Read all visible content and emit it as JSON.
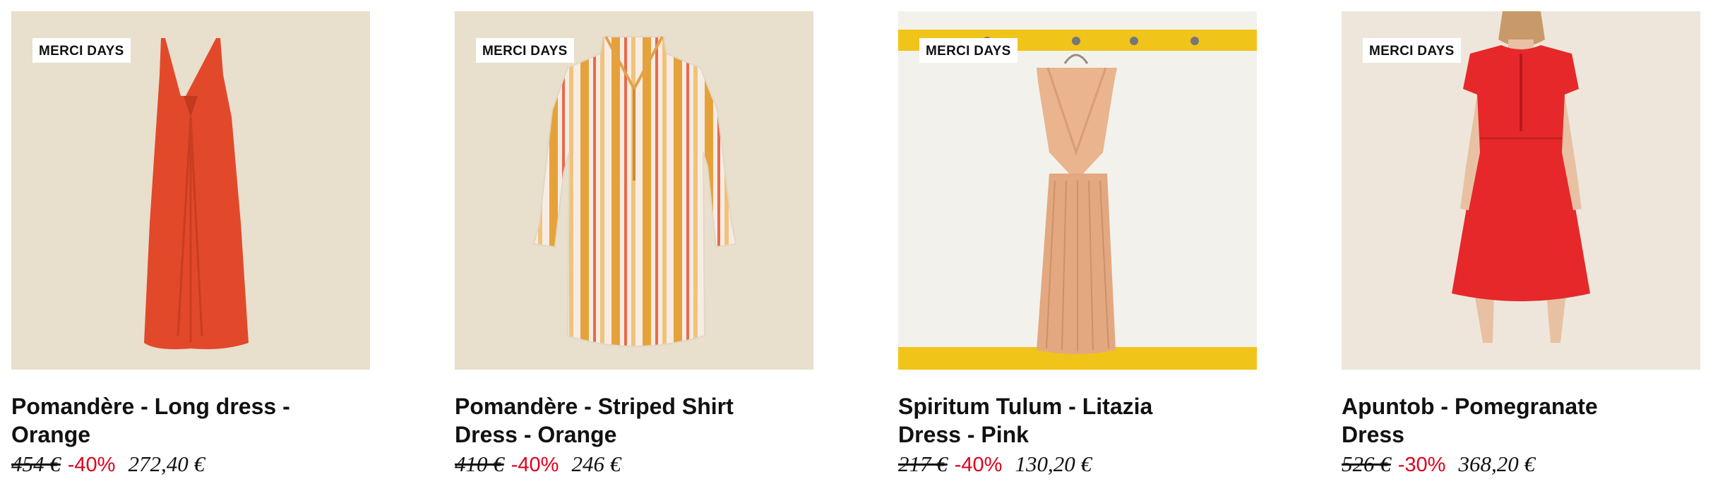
{
  "products": [
    {
      "badge": "MERCI DAYS",
      "title": "Pomandère - Long dress - Orange",
      "old_price": "454 €",
      "discount": "-40%",
      "new_price": "272,40 €",
      "image": "orange-long-dress-image"
    },
    {
      "badge": "MERCI DAYS",
      "title": "Pomandère - Striped Shirt Dress - Orange",
      "old_price": "410 €",
      "discount": "-40%",
      "new_price": "246 €",
      "image": "striped-shirt-dress-image"
    },
    {
      "badge": "MERCI DAYS",
      "title": "Spiritum Tulum - Litazia Dress - Pink",
      "old_price": "217 €",
      "discount": "-40%",
      "new_price": "130,20 €",
      "image": "pink-litazia-dress-image"
    },
    {
      "badge": "MERCI DAYS",
      "title": "Apuntob - Pomegranate Dress",
      "old_price": "526 €",
      "discount": "-30%",
      "new_price": "368,20 €",
      "image": "pomegranate-dress-image"
    }
  ],
  "colors": {
    "discount": "#e0001b",
    "beige_bg": "#e8dfcc",
    "yellow": "#f0c419"
  }
}
